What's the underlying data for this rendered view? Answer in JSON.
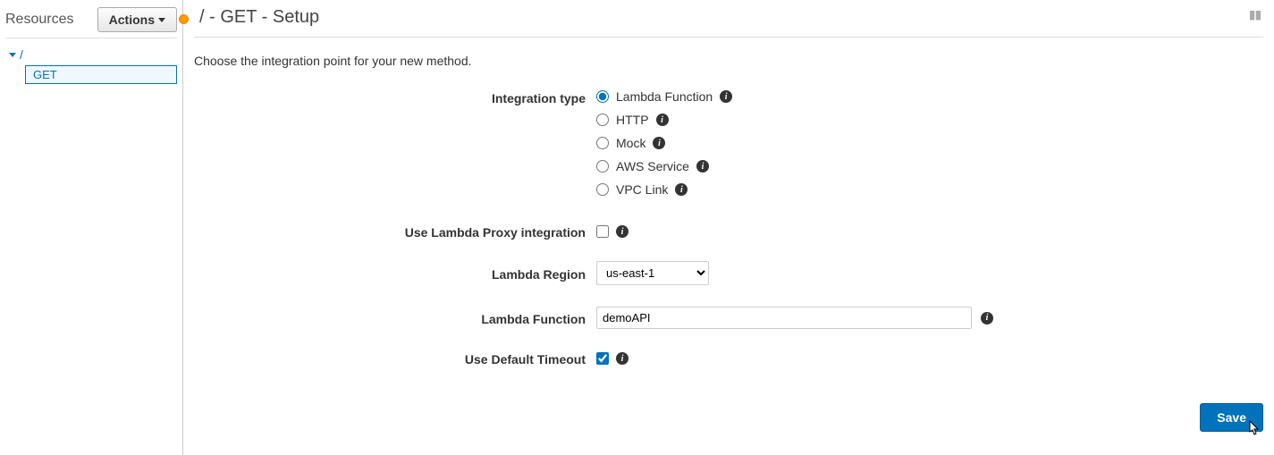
{
  "sidebar": {
    "title": "Resources",
    "actions_label": "Actions",
    "tree": {
      "root": "/",
      "method": "GET"
    }
  },
  "header": {
    "title": "/ - GET - Setup"
  },
  "intro": "Choose the integration point for your new method.",
  "form": {
    "integration_type_label": "Integration type",
    "integration_options": {
      "lambda": "Lambda Function",
      "http": "HTTP",
      "mock": "Mock",
      "aws": "AWS Service",
      "vpc": "VPC Link"
    },
    "integration_selected": "lambda",
    "proxy_label": "Use Lambda Proxy integration",
    "proxy_checked": false,
    "region_label": "Lambda Region",
    "region_value": "us-east-1",
    "function_label": "Lambda Function",
    "function_value": "demoAPI",
    "timeout_label": "Use Default Timeout",
    "timeout_checked": true
  },
  "buttons": {
    "save": "Save"
  }
}
